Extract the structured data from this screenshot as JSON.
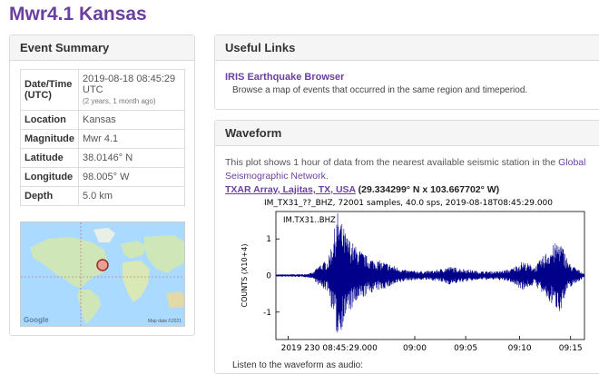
{
  "title": "Mwr4.1 Kansas",
  "summary": {
    "heading": "Event Summary",
    "rows": [
      {
        "key": "Date/Time (UTC)",
        "value": "2019-08-18 08:45:29 UTC",
        "note": "(2 years, 1 month ago)"
      },
      {
        "key": "Location",
        "value": "Kansas"
      },
      {
        "key": "Magnitude",
        "value": "Mwr 4.1"
      },
      {
        "key": "Latitude",
        "value": "38.0146° N"
      },
      {
        "key": "Longitude",
        "value": "98.005° W"
      },
      {
        "key": "Depth",
        "value": "5.0 km"
      }
    ]
  },
  "map": {
    "logo": "Google",
    "attribution": "Map data ©2021"
  },
  "links": {
    "heading": "Useful Links",
    "item_title": "IRIS Earthquake Browser",
    "item_desc": "Browse a map of events that occurred in the same region and timeperiod."
  },
  "waveform": {
    "heading": "Waveform",
    "desc_pre": "This plot shows 1 hour of data from the nearest available seismic station in the ",
    "desc_link": "Global Seismographic Network",
    "desc_post": ".",
    "station_name": "TXAR Array, Lajitas, TX, USA",
    "station_coords": " (29.334299° N x 103.667702° W)",
    "audio_label": "Listen to the waveform as audio:"
  },
  "chart_data": {
    "type": "line",
    "title": "IM_TX31_??_BHZ, 72001 samples, 40.0 sps, 2019-08-18T08:45:29.000",
    "trace_label": "IM.TX31..BHZ",
    "ylabel": "COUNTS (X10+4)",
    "y_ticks": [
      "1",
      "0",
      "-1"
    ],
    "x_ticks": [
      "2019 230 08:45:29.000",
      "09:00",
      "09:05",
      "09:10",
      "09:15"
    ],
    "ylim": [
      -1.75,
      1.75
    ],
    "envelope_x": [
      0.0,
      0.09,
      0.12,
      0.14,
      0.17,
      0.2,
      0.23,
      0.26,
      0.3,
      0.36,
      0.42,
      0.48,
      0.52,
      0.56,
      0.6,
      0.66,
      0.72,
      0.76,
      0.8,
      0.84,
      0.88,
      0.92,
      0.95,
      1.0
    ],
    "envelope_y": [
      0.03,
      0.04,
      0.08,
      0.3,
      0.45,
      1.75,
      1.1,
      0.8,
      0.5,
      0.35,
      0.15,
      0.12,
      0.15,
      0.25,
      0.2,
      0.12,
      0.12,
      0.18,
      0.4,
      0.25,
      0.7,
      1.0,
      0.35,
      0.05
    ],
    "line_color": "#00008b"
  }
}
